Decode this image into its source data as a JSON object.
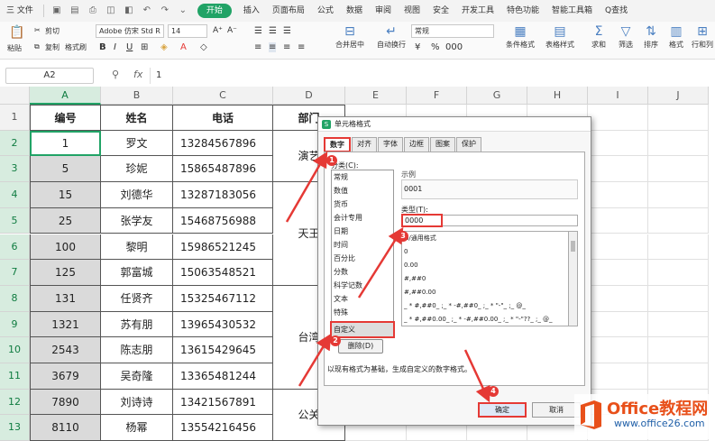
{
  "menubar": {
    "file": "三 文件",
    "start": "开始",
    "tabs": [
      "插入",
      "页面布局",
      "公式",
      "数据",
      "审阅",
      "视图",
      "安全",
      "开发工具",
      "特色功能",
      "智能工具箱"
    ],
    "search": "Q查找"
  },
  "ribbon": {
    "cut": "剪切",
    "paste": "粘贴",
    "copy": "复制",
    "format_painter": "格式刷",
    "font_name": "Adobe 仿宋 Std R",
    "font_size": "14",
    "bold": "B",
    "italic": "I",
    "underline": "U",
    "merge_center": "合并居中",
    "wrap": "自动换行",
    "number_format": "常规",
    "conditional_format": "条件格式",
    "table_style": "表格样式",
    "sum": "求和",
    "filter": "筛选",
    "sort": "排序",
    "format": "格式",
    "row_col": "行和列"
  },
  "formula_bar": {
    "name_box": "A2",
    "fx": "fx",
    "value": "1"
  },
  "grid": {
    "columns": [
      "A",
      "B",
      "C",
      "D",
      "E",
      "F",
      "G",
      "H",
      "I",
      "J"
    ],
    "rows": [
      "1",
      "2",
      "3",
      "4",
      "5",
      "6",
      "7",
      "8",
      "9",
      "10",
      "11",
      "12",
      "13"
    ],
    "headers": [
      "编号",
      "姓名",
      "电话",
      "部门"
    ],
    "data": [
      [
        "1",
        "罗文",
        "13284567896"
      ],
      [
        "5",
        "珍妮",
        "15865487896"
      ],
      [
        "15",
        "刘德华",
        "13287183056"
      ],
      [
        "25",
        "张学友",
        "15468756988"
      ],
      [
        "100",
        "黎明",
        "15986521245"
      ],
      [
        "125",
        "郭富城",
        "15063548521"
      ],
      [
        "131",
        "任贤齐",
        "15325467112"
      ],
      [
        "1321",
        "苏有朋",
        "13965430532"
      ],
      [
        "2543",
        "陈志朋",
        "13615429645"
      ],
      [
        "3679",
        "吴奇隆",
        "13365481244"
      ],
      [
        "7890",
        "刘诗诗",
        "13421567891"
      ],
      [
        "8110",
        "杨幂",
        "13554216456"
      ]
    ],
    "departments": [
      "演艺",
      "天王",
      "台湾",
      "公关"
    ]
  },
  "dialog": {
    "title": "单元格格式",
    "tabs": [
      "数字",
      "对齐",
      "字体",
      "边框",
      "图案",
      "保护"
    ],
    "category_label": "分类(C):",
    "categories": [
      "常规",
      "数值",
      "货币",
      "会计专用",
      "日期",
      "时间",
      "百分比",
      "分数",
      "科学记数",
      "文本",
      "特殊",
      "自定义"
    ],
    "sample_label": "示例",
    "sample_value": "0001",
    "type_label": "类型(T):",
    "type_value": "0000",
    "type_list": [
      "G/通用格式",
      "0",
      "0.00",
      "#,##0",
      "#,##0.00",
      "_ * #,##0_ ;_ * -#,##0_ ;_ * \"-\"_ ;_ @_",
      "_ * #,##0.00_ ;_ * -#,##0.00_ ;_ * \"-\"??_ ;_ @_"
    ],
    "delete_button": "删除(D)",
    "hint": "以现有格式为基础，生成自定义的数字格式。",
    "ok_button": "确定",
    "cancel_button": "取消"
  },
  "annotations": {
    "steps": [
      "1",
      "2",
      "3",
      "4"
    ],
    "color": "#e53935"
  },
  "watermark": {
    "title": "Office教程网",
    "url": "www.office26.com"
  },
  "colors": {
    "accent": "#21a366",
    "selection": "#d7ecdf",
    "highlight": "#e53935"
  }
}
